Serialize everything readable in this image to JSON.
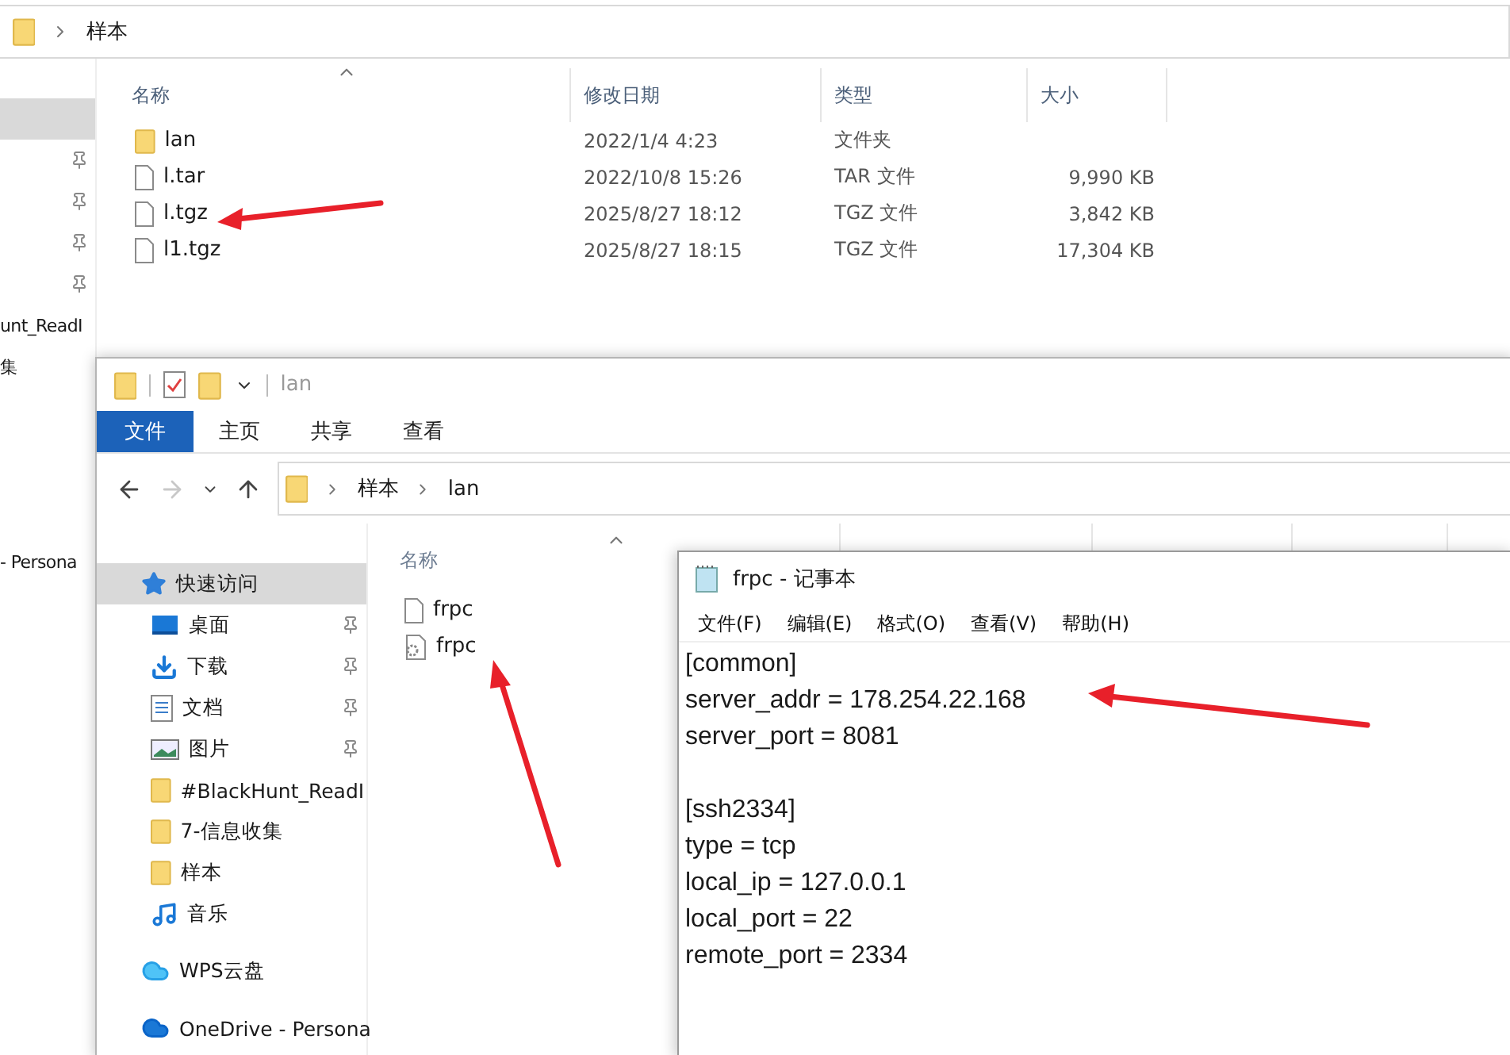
{
  "back_window": {
    "breadcrumb": [
      "样本"
    ],
    "sidebar": [
      {
        "kind": "blank",
        "selected": true,
        "pinned": false
      },
      {
        "kind": "blank",
        "selected": false,
        "pinned": true
      },
      {
        "kind": "blank",
        "selected": false,
        "pinned": true
      },
      {
        "kind": "blank",
        "selected": false,
        "pinned": true
      },
      {
        "kind": "blank",
        "selected": false,
        "pinned": true
      },
      {
        "kind": "text",
        "label": "unt_ReadI",
        "selected": false,
        "pinned": false
      },
      {
        "kind": "text",
        "label": "集",
        "selected": false,
        "pinned": false
      },
      {
        "kind": "cloud",
        "label": "- Persona",
        "selected": false,
        "pinned": false
      }
    ],
    "columns": [
      "名称",
      "修改日期",
      "类型",
      "大小"
    ],
    "files": [
      {
        "kind": "folder",
        "name": "lan",
        "modified": "2022/1/4 4:23",
        "type": "文件夹"
      },
      {
        "kind": "file",
        "name": "l.tar",
        "modified": "2022/10/8 15:26",
        "type": "TAR 文件",
        "size": "9,990 KB"
      },
      {
        "kind": "file",
        "name": "l.tgz",
        "modified": "2025/8/27 18:12",
        "type": "TGZ 文件",
        "size": "3,842 KB"
      },
      {
        "kind": "file",
        "name": "l1.tgz",
        "modified": "2025/8/27 18:15",
        "type": "TGZ 文件",
        "size": "17,304 KB"
      }
    ]
  },
  "front_window": {
    "title": "lan",
    "ribbon_tabs": [
      {
        "label": "文件",
        "selected": true
      },
      {
        "label": "主页",
        "selected": false
      },
      {
        "label": "共享",
        "selected": false
      },
      {
        "label": "查看",
        "selected": false
      }
    ],
    "breadcrumb": [
      "样本",
      "lan"
    ],
    "sidebar": [
      {
        "kind": "quick",
        "label": "快速访问",
        "selected": true,
        "pinned": false
      },
      {
        "kind": "desktop",
        "label": "桌面",
        "selected": false,
        "pinned": true
      },
      {
        "kind": "download",
        "label": "下载",
        "selected": false,
        "pinned": true
      },
      {
        "kind": "docs",
        "label": "文档",
        "selected": false,
        "pinned": true
      },
      {
        "kind": "pictures",
        "label": "图片",
        "selected": false,
        "pinned": true
      },
      {
        "kind": "folder",
        "label": "#BlackHunt_ReadI",
        "selected": false,
        "pinned": false
      },
      {
        "kind": "folder",
        "label": "7-信息收集",
        "selected": false,
        "pinned": false
      },
      {
        "kind": "folder",
        "label": "样本",
        "selected": false,
        "pinned": false
      },
      {
        "kind": "music",
        "label": "音乐",
        "selected": false,
        "pinned": false
      },
      {
        "kind": "wps",
        "label": "WPS云盘",
        "selected": false,
        "pinned": false
      },
      {
        "kind": "onedrive",
        "label": "OneDrive - Persona",
        "selected": false,
        "pinned": false
      }
    ],
    "name_column": "名称",
    "files": [
      {
        "kind": "file",
        "name": "frpc"
      },
      {
        "kind": "config",
        "name": "frpc"
      }
    ]
  },
  "notepad": {
    "title": "frpc - 记事本",
    "menu": [
      "文件(F)",
      "编辑(E)",
      "格式(O)",
      "查看(V)",
      "帮助(H)"
    ],
    "sections": [
      {
        "lines": [
          "[common]",
          "server_addr = 178.254.22.168",
          "server_port = 8081"
        ]
      },
      {
        "lines": [
          "[ssh2334]",
          "type = tcp",
          "local_ip = 127.0.0.1",
          "local_port = 22",
          "remote_port = 2334"
        ]
      }
    ]
  }
}
